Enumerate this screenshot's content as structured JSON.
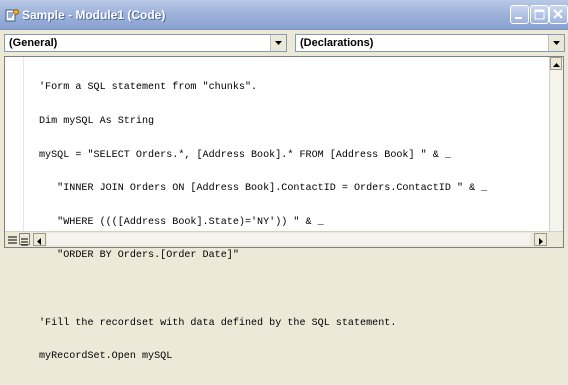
{
  "window": {
    "title": "Sample - Module1 (Code)",
    "colors": {
      "titlebar": "#9fb3db",
      "title_text": "#ffffff"
    }
  },
  "title_controls": {
    "minimize_icon": "minimize-icon",
    "maximize_icon": "maximize-icon",
    "close_icon": "close-icon"
  },
  "object_combo": {
    "value": "(General)"
  },
  "procedure_combo": {
    "value": "(Declarations)"
  },
  "code": {
    "lines": [
      "'Form a SQL statement from \"chunks\".",
      "Dim mySQL As String",
      "mySQL = \"SELECT Orders.*, [Address Book].* FROM [Address Book] \" & _",
      "   \"INNER JOIN Orders ON [Address Book].ContactID = Orders.ContactID \" & _",
      "   \"WHERE ((([Address Book].State)='NY')) \" & _",
      "   \"ORDER BY Orders.[Order Date]\"",
      "",
      "'Fill the recordset with data defined by the SQL statement.",
      "myRecordSet.Open mySQL"
    ]
  },
  "status_icons": {
    "procedure_view": "procedure-view-icon",
    "full_module_view": "full-module-view-icon"
  }
}
